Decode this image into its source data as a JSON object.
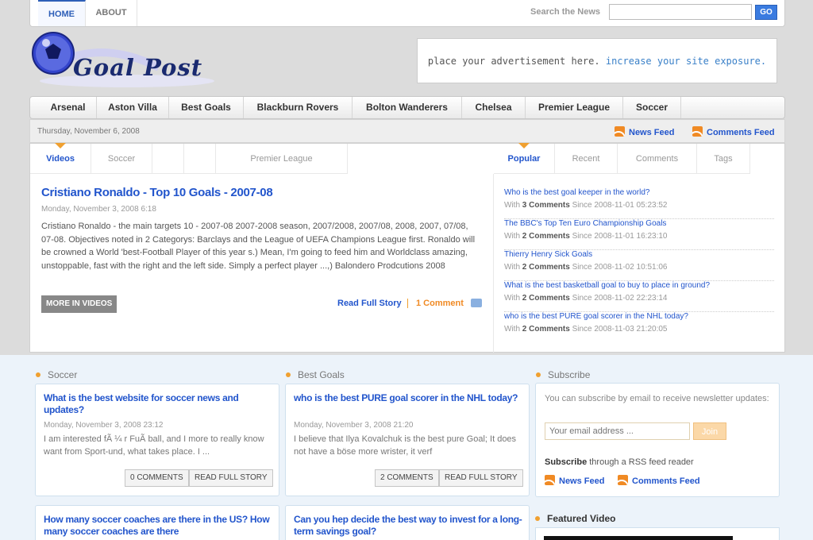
{
  "topnav": {
    "home": "HOME",
    "about": "ABOUT"
  },
  "search": {
    "label": "Search the News",
    "placeholder": "",
    "button": "GO"
  },
  "logo": {
    "text": "Goal Post"
  },
  "ad": {
    "text": "place your advertisement here.",
    "highlight": "increase your site exposure."
  },
  "nav": [
    "Arsenal",
    "Aston Villa",
    "Best Goals",
    "Blackburn Rovers",
    "Bolton Wanderers",
    "Chelsea",
    "Premier League",
    "Soccer"
  ],
  "datebar": {
    "date": "Thursday, November 6, 2008",
    "news_feed": "News Feed",
    "comments_feed": "Comments Feed"
  },
  "left_tabs": [
    "Videos",
    "Soccer",
    "Premier League"
  ],
  "right_tabs": [
    "Popular",
    "Recent",
    "Comments",
    "Tags"
  ],
  "video": {
    "title": "Cristiano Ronaldo - Top 10 Goals - 2007-08",
    "date": "Monday, November 3, 2008 6:18",
    "body": "Cristiano Ronaldo - the main targets 10 - 2007-08 2007-2008 season, 2007/2008, 2007/08, 2008, 2007, 07/08, 07-08. Objectives noted in 2 Categorys: Barclays and the League of UEFA Champions League first. Ronaldo will be crowned a World 'best-Football Player of this year s.) Mean, I'm going to feed him and Worldclass amazing, unstoppable, fast with the right and the left side. Simply a perfect player ...,) Balondero Prodcutions 2008",
    "more": "MORE IN VIDEOS",
    "read_full": "Read Full Story",
    "comments": "1 Comment"
  },
  "popular": [
    {
      "q": "Who is the best goal keeper in the world?",
      "count": "3 Comments",
      "since": "Since 2008-11-01 05:23:52"
    },
    {
      "q": "The BBC's Top Ten Euro Championship Goals",
      "count": "2 Comments",
      "since": "Since 2008-11-01 16:23:10"
    },
    {
      "q": "Thierry Henry Sick Goals",
      "count": "2 Comments",
      "since": "Since 2008-11-02 10:51:06"
    },
    {
      "q": "What is the best basketball goal to buy to place in ground?",
      "count": "2 Comments",
      "since": "Since 2008-11-02 22:23:14"
    },
    {
      "q": "who is the best PURE goal scorer in the NHL today?",
      "count": "2 Comments",
      "since": "Since 2008-11-03 21:20:05"
    }
  ],
  "with_label": "With",
  "sections": {
    "soccer": "Soccer",
    "best_goals": "Best Goals",
    "subscribe": "Subscribe",
    "featured": "Featured Video"
  },
  "cards": [
    {
      "title": "What is the best website for soccer news and updates?",
      "date": "Monday, November 3, 2008 23:12",
      "body": "I am interested fÃ ¼ r FuÃ  ball, and I more to really know want from Sport-und, what takes place. I ...",
      "comments": "0 COMMENTS",
      "read": "READ FULL STORY"
    },
    {
      "title": "who is the best PURE goal scorer in the NHL today?",
      "date": "Monday, November 3, 2008 21:20",
      "body": "I believe that Ilya Kovalchuk is the best pure Goal; It does not have a böse more wrister, it verf",
      "comments": "2 COMMENTS",
      "read": "READ FULL STORY"
    }
  ],
  "cards2": [
    {
      "title": "How many soccer coaches are there in the US? How many soccer coaches are there"
    },
    {
      "title": "Can you hep decide the best way to invest for a long-term savings goal?"
    }
  ],
  "subscribe": {
    "text": "You can subscribe by email to receive newsletter updates:",
    "email_placeholder": "Your email address ...",
    "join": "Join",
    "rss_bold": "Subscribe",
    "rss_rest": " through a RSS feed reader",
    "news_feed": "News Feed",
    "comments_feed": "Comments Feed"
  },
  "colors": {
    "accent": "#2255cc",
    "orange": "#f08a24",
    "background": "#dcdcdc"
  }
}
